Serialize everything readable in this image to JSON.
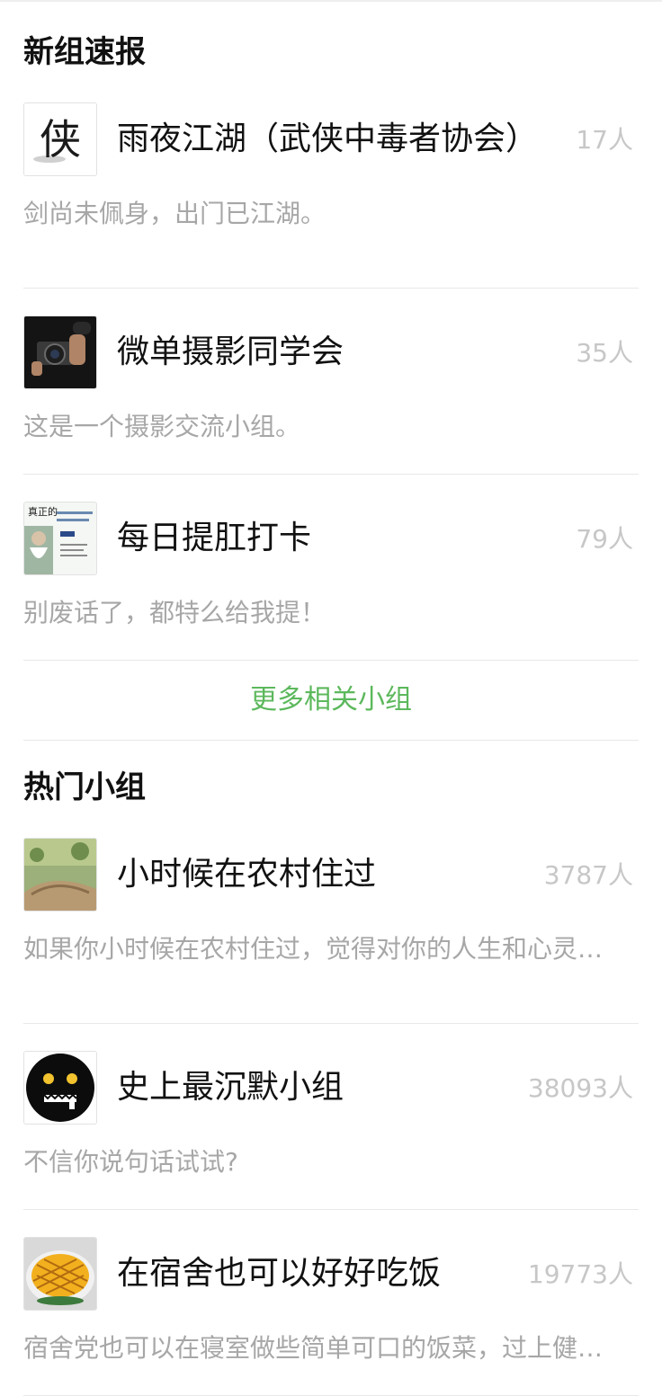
{
  "new_groups": {
    "title": "新组速报",
    "items": [
      {
        "name": "雨夜江湖（武侠中毒者协会）",
        "count": "17人",
        "desc": "剑尚未佩身，出门已江湖。",
        "avatar_text": "侠",
        "avatar_icon": "calligraphy-avatar-icon"
      },
      {
        "name": "微单摄影同学会",
        "count": "35人",
        "desc": "这是一个摄影交流小组。",
        "avatar_icon": "camera-person-avatar-icon"
      },
      {
        "name": "每日提肛打卡",
        "count": "79人",
        "desc": "别废话了，都特么给我提！",
        "avatar_text": "真正的",
        "avatar_icon": "old-man-poster-avatar-icon"
      }
    ],
    "more_label": "更多相关小组"
  },
  "hot_groups": {
    "title": "热门小组",
    "items": [
      {
        "name": "小时候在农村住过",
        "count": "3787人",
        "desc": "如果你小时候在农村住过，觉得对你的人生和心灵有影响",
        "avatar_icon": "countryside-avatar-icon"
      },
      {
        "name": "史上最沉默小组",
        "count": "38093人",
        "desc": "不信你说句话试试?",
        "avatar_icon": "zipper-mouth-face-avatar-icon"
      },
      {
        "name": "在宿舍也可以好好吃饭",
        "count": "19773人",
        "desc": "宿舍党也可以在寝室做些简单可口的饭菜，过上健康的生活",
        "avatar_icon": "omelette-dish-avatar-icon"
      }
    ]
  },
  "colors": {
    "link_green": "#5cb85c",
    "muted_gray": "#a7a7a7",
    "count_gray": "#c7c7c7"
  }
}
